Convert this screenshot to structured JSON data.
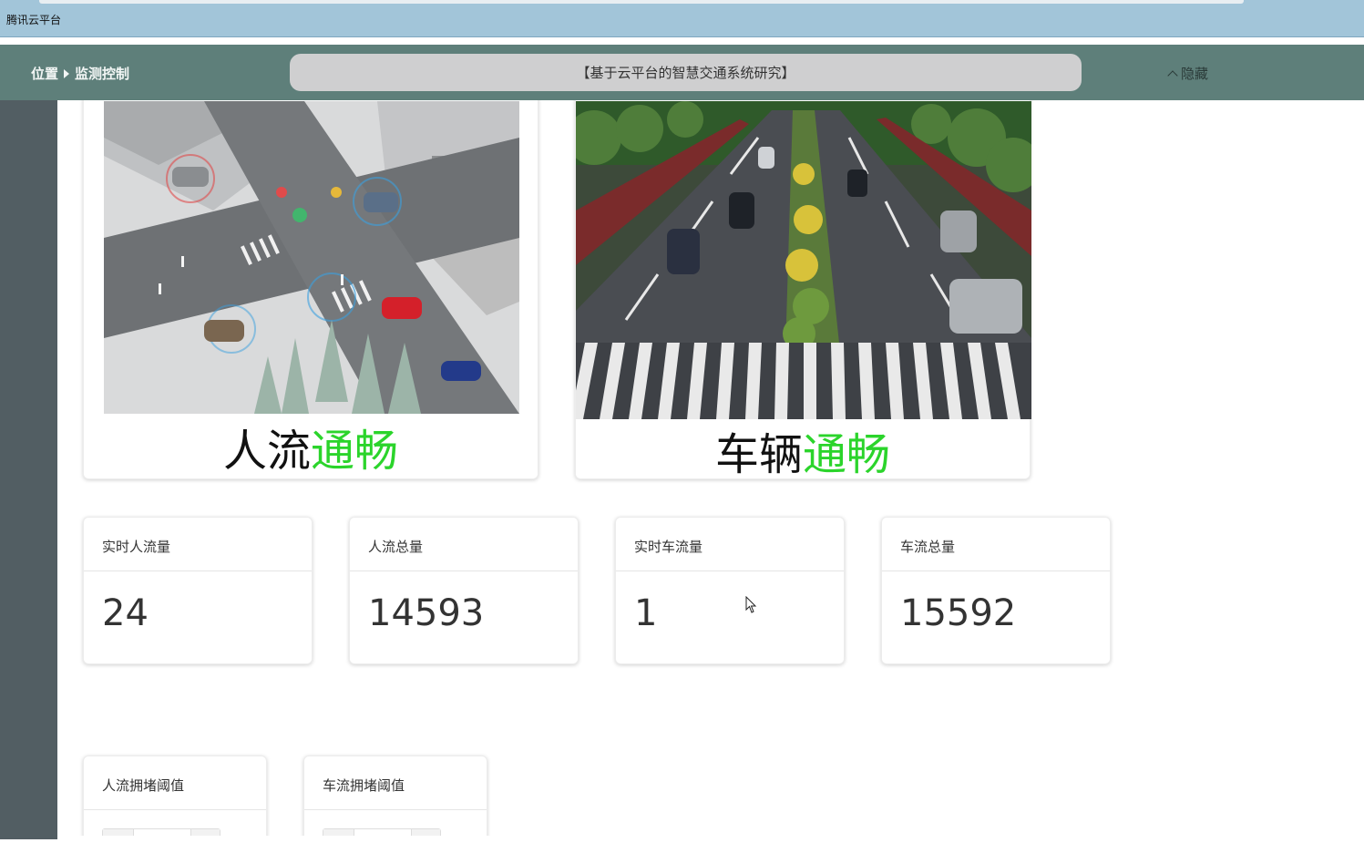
{
  "window": {
    "title": "腾讯云平台"
  },
  "header": {
    "breadcrumb_root": "位置",
    "breadcrumb_current": "监测控制",
    "banner": "【基于云平台的智慧交通系统研究】",
    "hide_label": "隐藏"
  },
  "status_cards": [
    {
      "subject": "人流",
      "status": "通畅",
      "image": "pedestrian-intersection-illustration"
    },
    {
      "subject": "车辆",
      "status": "通畅",
      "image": "road-traffic-photo"
    }
  ],
  "stats": [
    {
      "label": "实时人流量",
      "value": "24"
    },
    {
      "label": "人流总量",
      "value": "14593"
    },
    {
      "label": "实时车流量",
      "value": "1"
    },
    {
      "label": "车流总量",
      "value": "15592"
    }
  ],
  "thresholds": [
    {
      "label": "人流拥堵阈值"
    },
    {
      "label": "车流拥堵阈值"
    }
  ],
  "colors": {
    "header_bg": "#5e7f7a",
    "sidebar_bg": "#525e63",
    "status_ok": "#2bd42b",
    "titlebar_bg": "#a2c5d9"
  }
}
